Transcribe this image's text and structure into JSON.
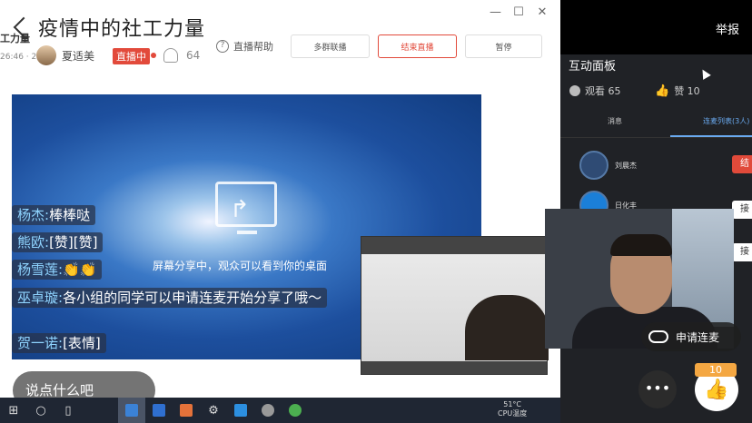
{
  "window": {
    "title": "疫情中的社工力量",
    "brand_short": "工力量",
    "time": "26:46 · 2",
    "host_name": "夏适美",
    "live_badge": "直播中",
    "viewer_count": "64",
    "help_label": "直播帮助",
    "buttons": {
      "multi_connect": "多群联播",
      "end_live": "结束直播",
      "pause": "暂停"
    },
    "controls": {
      "minimize": "—",
      "maximize": "☐",
      "close": "✕"
    }
  },
  "screen_share": {
    "message": "屏幕分享中，观众可以看到你的桌面"
  },
  "chat": [
    {
      "user": "杨杰:",
      "text": "棒棒哒"
    },
    {
      "user": "熊欧:",
      "text": "[赞][赞]"
    },
    {
      "user": "杨雪莲:",
      "text": "👏👏"
    },
    {
      "user": "巫卓璇:",
      "text": "各小组的同学可以申请连麦开始分享了哦～"
    },
    {
      "user": "贺一诺:",
      "text": "[表情]"
    }
  ],
  "chat_input": {
    "placeholder": "说点什么吧"
  },
  "taskbar": {
    "temp": "51°C",
    "temp_label": "CPU温度"
  },
  "panel": {
    "report": "举报",
    "title": "互动面板",
    "viewers": "观看 65",
    "likes": "赞 10",
    "tabs": [
      "消息",
      "连麦列表(3人)"
    ],
    "requests": [
      {
        "name": "刘晨杰",
        "action": "结"
      },
      {
        "name": "日化丰",
        "action": "接"
      }
    ],
    "accept_second": "接"
  },
  "bottom": {
    "apply_mic": "申请连麦",
    "more": "•••",
    "like_count": "10"
  },
  "colors": {
    "accent_red": "#e24a3b",
    "accent_blue": "#6aaaf0",
    "like_orange": "#f4a742"
  }
}
